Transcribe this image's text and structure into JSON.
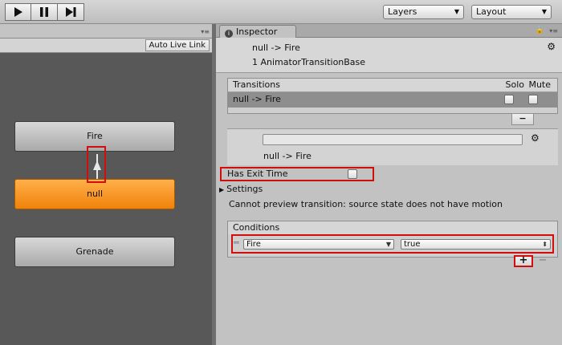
{
  "toolbar": {
    "play_icon": "play-icon",
    "pause_icon": "pause-icon",
    "step_icon": "step-icon",
    "layers_label": "Layers",
    "layout_label": "Layout"
  },
  "animator": {
    "auto_live_link": "Auto Live Link",
    "states": [
      {
        "name": "Fire",
        "style": "grey"
      },
      {
        "name": "null",
        "style": "default"
      },
      {
        "name": "Grenade",
        "style": "grey"
      }
    ]
  },
  "inspector": {
    "tab_label": "Inspector",
    "header": {
      "title": "null -> Fire",
      "type": "1 AnimatorTransitionBase"
    },
    "transitions": {
      "header": "Transitions",
      "solo": "Solo",
      "mute": "Mute",
      "rows": [
        {
          "label": "null -> Fire",
          "solo": false,
          "mute": false
        }
      ],
      "remove_label": "−"
    },
    "transition_name": {
      "value": "",
      "label": "null -> Fire"
    },
    "has_exit_time": {
      "label": "Has Exit Time",
      "checked": false
    },
    "settings_label": "Settings",
    "preview_message": "Cannot preview transition: source state does not have motion",
    "conditions": {
      "header": "Conditions",
      "rows": [
        {
          "parameter": "Fire",
          "value": "true"
        }
      ],
      "add_label": "+",
      "remove_label": "−"
    }
  },
  "colors": {
    "highlight": "#d20d0d",
    "default_state": "#f0820a",
    "graph_background": "#585858"
  }
}
